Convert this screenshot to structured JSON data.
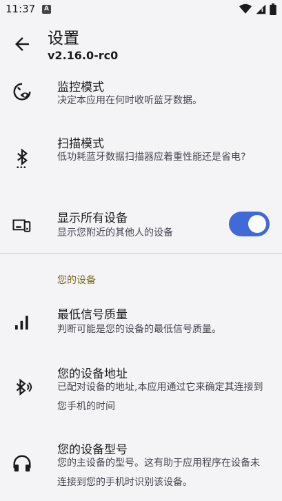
{
  "status_bar": {
    "time": "11:37",
    "notification_letter": "A",
    "icons": [
      "wifi-icon",
      "cell-signal-icon",
      "battery-icon"
    ]
  },
  "app_bar": {
    "title": "设置",
    "version": "v2.16.0-rc0",
    "back_icon": "arrow-back-icon"
  },
  "settings": [
    {
      "id": "monitor-mode",
      "icon": "monitor-eye-icon",
      "title": "监控模式",
      "subtitle": "决定本应用在何时收听蓝牙数据。"
    },
    {
      "id": "scan-mode",
      "icon": "bluetooth-searching-icon",
      "title": "扫描模式",
      "subtitle": "低功耗蓝牙数据扫描器应着重性能还是省电?"
    },
    {
      "id": "show-all-devices",
      "icon": "devices-icon",
      "title": "显示所有设备",
      "subtitle": "显示您附近的其他人的设备",
      "toggle_on": true
    }
  ],
  "section": {
    "header": "您的设备",
    "header_color": "#7a6a1c"
  },
  "device_settings": [
    {
      "id": "min-signal",
      "icon": "signal-bars-icon",
      "title": "最低信号质量",
      "subtitle": "判断可能是您的设备的最低信号质量。"
    },
    {
      "id": "device-address",
      "icon": "bluetooth-connected-icon",
      "title": "您的设备地址",
      "subtitle": "已配对设备的地址,本应用通过它来确定其连接到您手机的时间"
    },
    {
      "id": "device-model",
      "icon": "headphones-icon",
      "title": "您的设备型号",
      "subtitle": "您的主设备的型号。这有助于应用程序在设备未连接到您的手机时识别该设备。"
    }
  ],
  "colors": {
    "accent": "#3f6ad8",
    "background": "#f4f4f7",
    "text": "#1b1b1f"
  }
}
